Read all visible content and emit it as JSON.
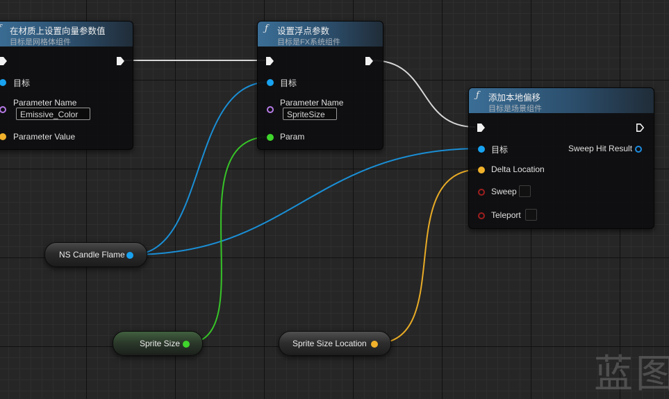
{
  "colors": {
    "exec_wire": "#dddddd",
    "object_pin": "#18a2f0",
    "float_pin": "#3fd52c",
    "vector_pin": "#f1b12b",
    "name_pin": "#b77be8",
    "bool_pin": "#9e1e1e",
    "header_accent": "#3b6e96"
  },
  "nodes": {
    "set_vector_param": {
      "title": "在材质上设置向量参数值",
      "subtitle": "目标是网格体组件",
      "icon": "function-icon",
      "target_label": "目标",
      "param_name_label": "Parameter Name",
      "param_name_value": "Emissive_Color",
      "param_value_label": "Parameter Value"
    },
    "set_float_param": {
      "title": "设置浮点参数",
      "subtitle": "目标是FX系统组件",
      "icon": "function-icon",
      "target_label": "目标",
      "param_name_label": "Parameter Name",
      "param_name_value": "SpriteSize",
      "param_label": "Param"
    },
    "add_local_offset": {
      "title": "添加本地偏移",
      "subtitle": "目标是场景组件",
      "icon": "function-icon",
      "target_label": "目标",
      "sweep_hit_label": "Sweep Hit Result",
      "delta_label": "Delta Location",
      "sweep_label": "Sweep",
      "teleport_label": "Teleport"
    }
  },
  "variables": {
    "ns_candle_flame": "NS Candle Flame",
    "sprite_size": "Sprite Size",
    "sprite_size_location": "Sprite Size Location"
  },
  "watermark": "蓝图"
}
